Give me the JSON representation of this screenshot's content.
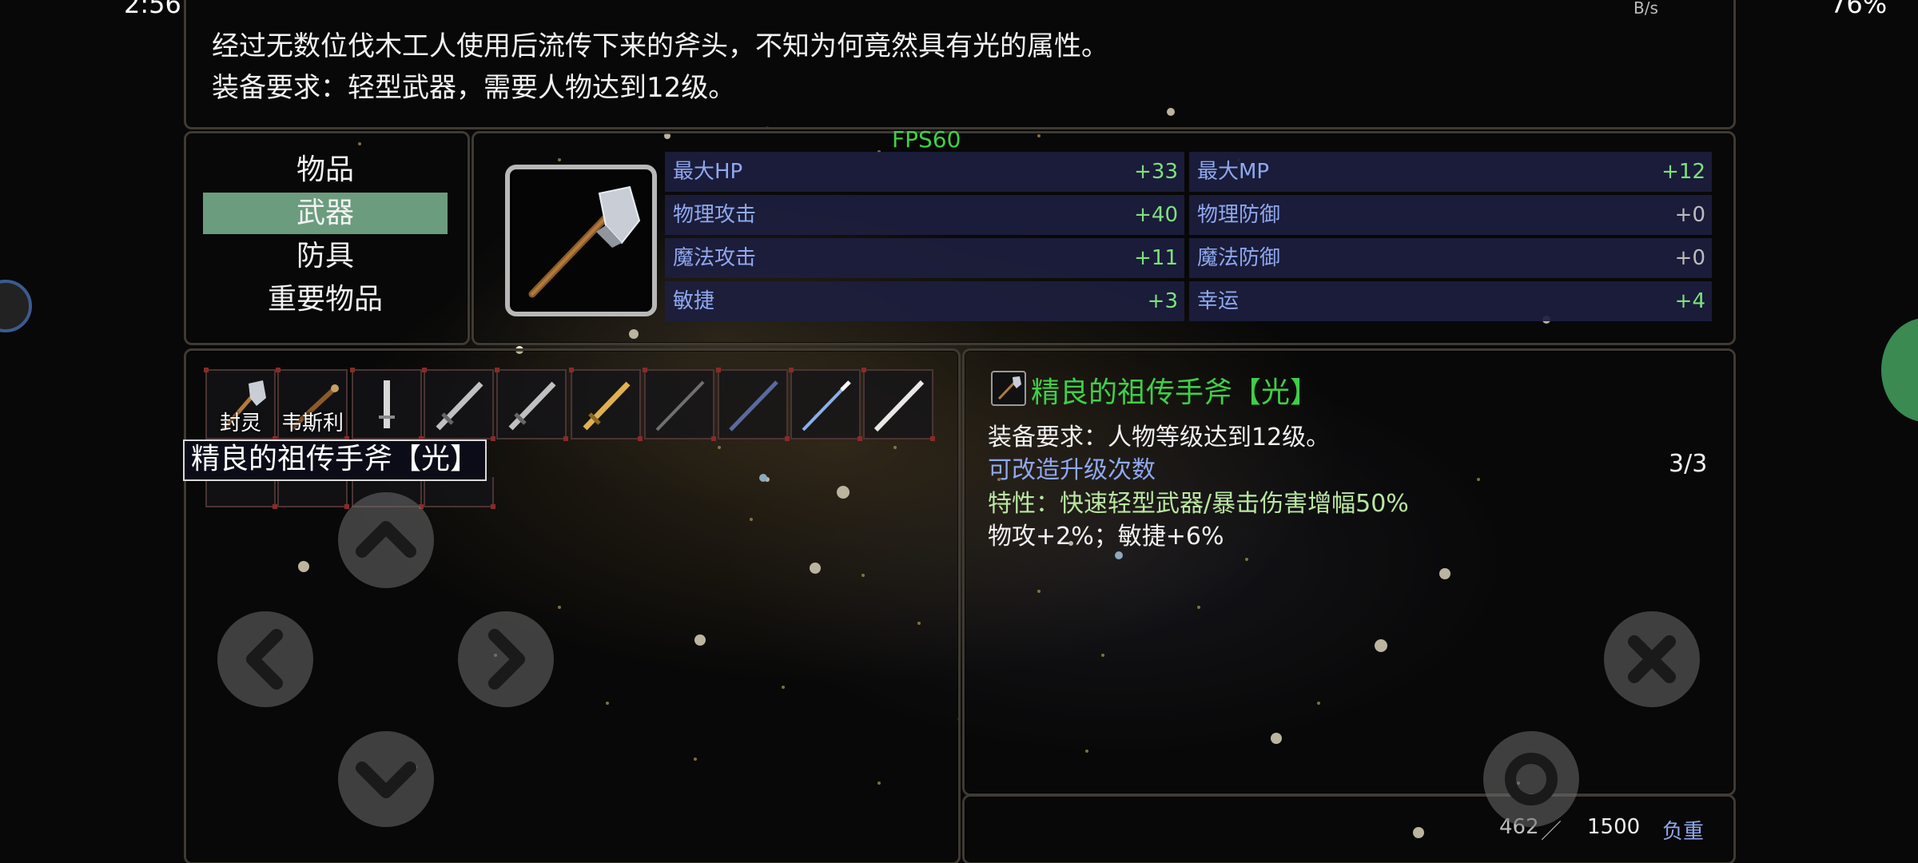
{
  "status_bar": {
    "time": "2:56",
    "net_unit": "B/s",
    "battery": "76%"
  },
  "description": {
    "line1": "经过无数位伐木工人使用后流传下来的斧头，不知为何竟然具有光的属性。",
    "line2": "装备要求：轻型武器，需要人物达到12级。"
  },
  "fps": "FPS60",
  "categories": [
    {
      "label": "物品",
      "selected": false
    },
    {
      "label": "武器",
      "selected": true
    },
    {
      "label": "防具",
      "selected": false
    },
    {
      "label": "重要物品",
      "selected": false
    }
  ],
  "stats": [
    {
      "name": "最大HP",
      "value": "+33"
    },
    {
      "name": "最大MP",
      "value": "+12"
    },
    {
      "name": "物理攻击",
      "value": "+40"
    },
    {
      "name": "物理防御",
      "value": "+0"
    },
    {
      "name": "魔法攻击",
      "value": "+11"
    },
    {
      "name": "魔法防御",
      "value": "+0"
    },
    {
      "name": "敏捷",
      "value": "+3"
    },
    {
      "name": "幸运",
      "value": "+4"
    }
  ],
  "slots": [
    {
      "label": "封灵",
      "icon": "axe-icon"
    },
    {
      "label": "韦斯利",
      "icon": "staff-icon"
    },
    {
      "label": "",
      "icon": "dagger-icon"
    },
    {
      "label": "",
      "icon": "sword-icon"
    },
    {
      "label": "",
      "icon": "sword-icon"
    },
    {
      "label": "",
      "icon": "golden-sword-icon"
    },
    {
      "label": "",
      "icon": "katana-icon"
    },
    {
      "label": "",
      "icon": "blue-katana-icon"
    },
    {
      "label": "",
      "icon": "blue-spear-icon"
    },
    {
      "label": "",
      "icon": "white-blade-icon"
    }
  ],
  "tooltip": "精良的祖传手斧【光】",
  "detail": {
    "name": "精良的祖传手斧【光】",
    "requirement": "装备要求：人物等级达到12级。",
    "upgrade_label": "可改造升级次数",
    "upgrade_value": "3/3",
    "trait": "特性：快速轻型武器/暴击伤害增幅50%",
    "bonus": "物攻+2%；敏捷+6%"
  },
  "weight": {
    "current": "462",
    "separator": "／",
    "max": "1500",
    "label": "负重"
  },
  "controls": {
    "up": "up-arrow-icon",
    "left": "left-arrow-icon",
    "right": "right-arrow-icon",
    "down": "down-arrow-icon",
    "close": "close-icon",
    "confirm": "ring-icon"
  },
  "colors": {
    "selected_category": "#6b9c7e",
    "item_name": "#3fcf48",
    "stat_label": "#8fa8ef",
    "stat_value": "#7fe07f",
    "fps": "#3fcf48"
  }
}
